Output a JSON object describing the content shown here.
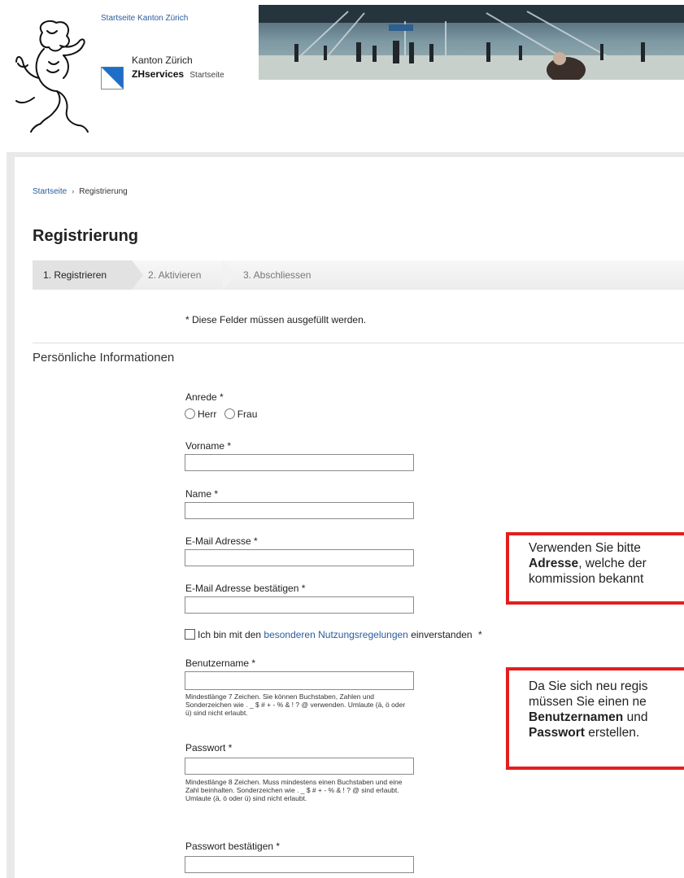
{
  "header": {
    "top_link": "Startseite Kanton Zürich",
    "kanton": "Kanton Zürich",
    "brand_name": "ZHservices",
    "brand_start": "Startseite"
  },
  "breadcrumb": {
    "home": "Startseite",
    "separator": "›",
    "current": "Registrierung"
  },
  "page": {
    "title": "Registrierung",
    "required_note": "* Diese Felder müssen ausgefüllt werden.",
    "section_title": "Persönliche Informationen"
  },
  "steps": [
    {
      "label": "1. Registrieren",
      "active": true
    },
    {
      "label": "2. Aktivieren",
      "active": false
    },
    {
      "label": "3. Abschliessen",
      "active": false
    }
  ],
  "form": {
    "anrede_label": "Anrede *",
    "anrede_options": [
      "Herr",
      "Frau"
    ],
    "vorname_label": "Vorname *",
    "vorname_value": "",
    "name_label": "Name *",
    "name_value": "",
    "email_label": "E-Mail Adresse *",
    "email_value": "",
    "email_confirm_label": "E-Mail Adresse bestätigen *",
    "email_confirm_value": "",
    "terms_prefix": "Ich bin mit den",
    "terms_link": "besonderen Nutzungsregelungen",
    "terms_suffix": "einverstanden",
    "terms_required": "*",
    "username_label": "Benutzername *",
    "username_value": "",
    "username_hint": "Mindestlänge 7 Zeichen. Sie können Buchstaben, Zahlen und Sonderzeichen wie . _ $ # + - % & ! ? @ verwenden. Umlaute (ä, ö oder ü) sind nicht erlaubt.",
    "password_label": "Passwort *",
    "password_value": "",
    "password_hint": "Mindestlänge 8 Zeichen. Muss mindestens einen Buchstaben und eine Zahl beinhalten. Sonderzeichen wie . _ $ # + - % & ! ? @ sind erlaubt. Umlaute (ä, ö oder ü) sind nicht erlaubt.",
    "password_confirm_label": "Passwort bestätigen *",
    "password_confirm_value": ""
  },
  "notes": {
    "note1_line1": "Verwenden Sie bitte",
    "note1_bold": "Adresse",
    "note1_line2_rest": ", welche der",
    "note1_line3": "kommission bekannt",
    "note2_line1": "Da Sie sich neu regis",
    "note2_line2": "müssen Sie einen ne",
    "note2_bold1": "Benutzernamen",
    "note2_line3_rest": " und",
    "note2_bold2": "Passwort",
    "note2_line4_rest": " erstellen."
  },
  "colors": {
    "link": "#2a5d9c",
    "note_border": "#e31e1e",
    "zh_logo_blue": "#1e6ec8"
  }
}
